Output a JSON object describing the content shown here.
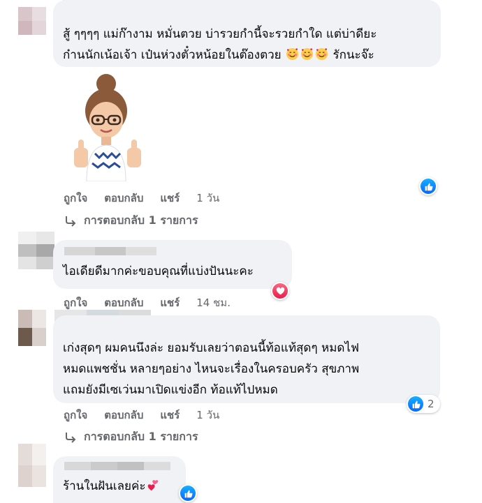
{
  "colors": {
    "bubble": "#f0f2f5",
    "meta": "#65676b",
    "like": "#0866ff",
    "love": "#e61e4d"
  },
  "comments": [
    {
      "lines": [
        "สู้ ๆๆๆๆ แม่ก๊างาม หมั่นตวย บ่ารวยกำนี้จะรวยกำใด แต่บ่าดียะ",
        "ก๋านนักเน้อเจ้า เป๋นห่วงตั๋วหน้อยในต๊องตวย"
      ],
      "line2_suffix": "รักนะจ๊ะ",
      "emojis": [
        "smiling-face-with-hearts-icon",
        "smiling-face-with-hearts-icon",
        "smiling-face-with-hearts-icon"
      ],
      "sticker": "avatar-sticker-thumbs-up",
      "actions": {
        "like": "ถูกใจ",
        "reply": "ตอบกลับ",
        "share": "แชร์",
        "time": "1 วัน"
      },
      "reaction": {
        "type": "like-icon"
      },
      "replies_link": "การตอบกลับ 1 รายการ"
    },
    {
      "lines": [
        "ไอเดียดีมากค่ะขอบคุณที่แบ่งปันนะคะ"
      ],
      "actions": {
        "like": "ถูกใจ",
        "reply": "ตอบกลับ",
        "share": "แชร์",
        "time": "14 ชม."
      },
      "reaction": {
        "type": "love-icon"
      }
    },
    {
      "lines": [
        "เก่งสุดๆ ผมคนนึงล่ะ ยอมรับเลยว่าตอนนี้ท้อแท้สุดๆ หมดไฟ",
        "หมดแพชชั่น หลายๆอย่าง ไหนจะเรื่องในครอบครัว สุขภาพ",
        "แถมยังมีเซเว่นมาเปิดแข่งอีก ท้อแท้ไปหมด"
      ],
      "actions": {
        "like": "ถูกใจ",
        "reply": "ตอบกลับ",
        "share": "แชร์",
        "time": "1 วัน"
      },
      "reaction": {
        "type": "like-icon",
        "count": "2"
      },
      "replies_link": "การตอบกลับ 1 รายการ"
    },
    {
      "lines": [
        "ร้านในฝันเลยค่ะ"
      ],
      "emojis": [
        "two-hearts-icon"
      ],
      "reaction": {
        "type": "like-icon"
      }
    }
  ]
}
